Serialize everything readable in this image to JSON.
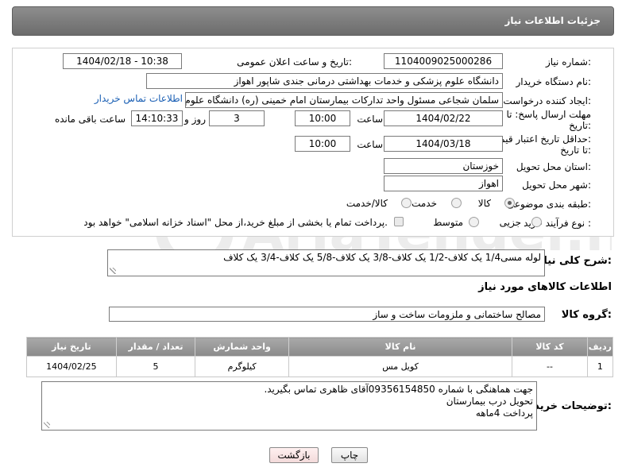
{
  "header": {
    "title": "جزئیات اطلاعات نیاز"
  },
  "form": {
    "need_number_label": "شماره نیاز:",
    "need_number": "1104009025000286",
    "announce_label": "تاریخ و ساعت اعلان عمومی:",
    "announce_value": "1404/02/18 - 10:38",
    "buyer_org_label": "نام دستگاه خریدار:",
    "buyer_org": "دانشگاه علوم پزشکی و خدمات بهداشتی درمانی جندی شاپور اهواز",
    "requester_label": "ایجاد کننده درخواست:",
    "requester": "سلمان شجاعی مسئول واحد تدارکات بیمارستان امام خمینی (ره) دانشگاه علوم",
    "contact_link": "اطلاعات تماس خریدار",
    "deadline_label_1": "مهلت ارسال پاسخ: تا",
    "deadline_label_2": "تاریخ:",
    "deadline_date": "1404/02/22",
    "time_label": "ساعت",
    "deadline_time": "10:00",
    "days_value": "3",
    "days_label": "روز و",
    "remaining_time": "14:10:33",
    "remaining_label": "ساعت باقی مانده",
    "price_label_1": "حداقل تاریخ اعتبار قیمت:",
    "price_label_2": "تا تاریخ:",
    "price_date": "1404/03/18",
    "price_time": "10:00",
    "province_label": "استان محل تحویل:",
    "province": "خوزستان",
    "city_label": "شهر محل تحویل:",
    "city": "اهواز",
    "category_label": "طبقه بندی موضوعی:",
    "category_options": [
      "کالا",
      "خدمت",
      "کالا/خدمت"
    ],
    "process_label": "نوع فرآیند خرید :",
    "process_options": [
      "جزیی",
      "متوسط"
    ],
    "payment_note": "پرداخت تمام یا بخشی از مبلغ خرید،از محل \"اسناد خزانه اسلامی\" خواهد بود."
  },
  "description": {
    "label": "شرح کلی نیاز:",
    "text": "لوله مسی1/4  یک کلاف-1/2  یک کلاف-3/8 یک کلاف-5/8 یک کلاف-3/4  یک کلاف"
  },
  "goods_section": {
    "title": "اطلاعات کالاهای مورد نیاز",
    "group_label": "گروه کالا:",
    "group_value": "مصالح ساختمانی و ملزومات ساخت و ساز"
  },
  "table": {
    "headers": [
      "ردیف",
      "کد کالا",
      "نام کالا",
      "واحد شمارش",
      "تعداد / مقدار",
      "تاریخ نیاز"
    ],
    "rows": [
      [
        "1",
        "--",
        "کویل مس",
        "کیلوگرم",
        "5",
        "1404/02/25"
      ]
    ]
  },
  "buyer_notes": {
    "label": "توضیحات خریدار:",
    "lines": [
      "جهت هماهنگی با شماره 09356154850آقای ظاهری تماس بگیرید.",
      "تحویل درب بیمارستان",
      "پرداخت 4ماهه"
    ]
  },
  "buttons": {
    "print": "چاپ",
    "back": "بازگشت"
  },
  "colors": {
    "header_bg": "#7c7c7c",
    "link": "#1a5fb4",
    "table_header": "#9a9a9a"
  }
}
